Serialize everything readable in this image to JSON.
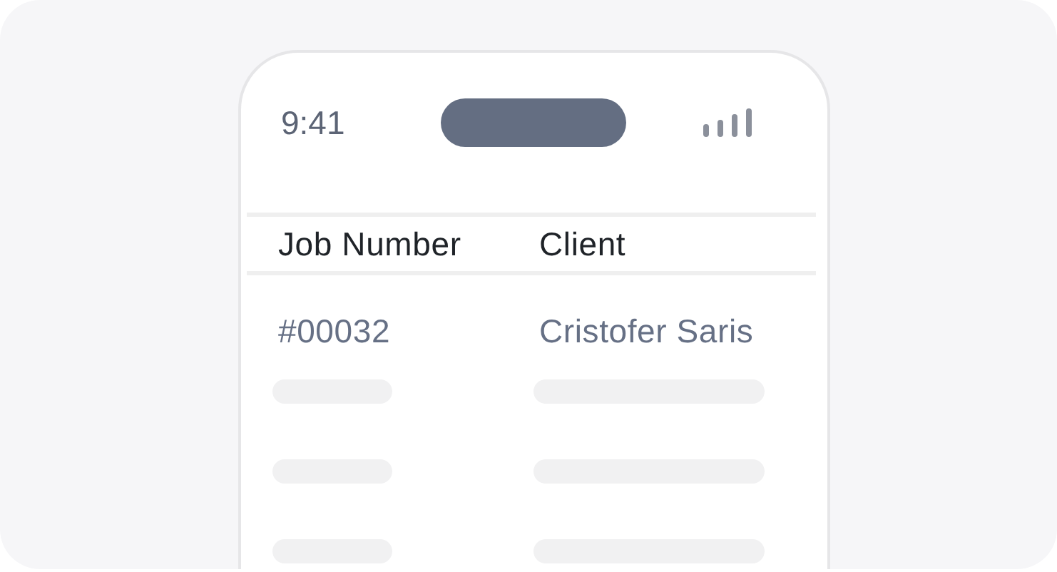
{
  "status_bar": {
    "time": "9:41"
  },
  "table": {
    "columns": [
      "Job Number",
      "Client"
    ],
    "rows": [
      {
        "kind": "data",
        "cells": [
          "#00032",
          "Cristofer Saris"
        ]
      },
      {
        "kind": "skeleton"
      },
      {
        "kind": "skeleton"
      },
      {
        "kind": "skeleton"
      }
    ]
  }
}
